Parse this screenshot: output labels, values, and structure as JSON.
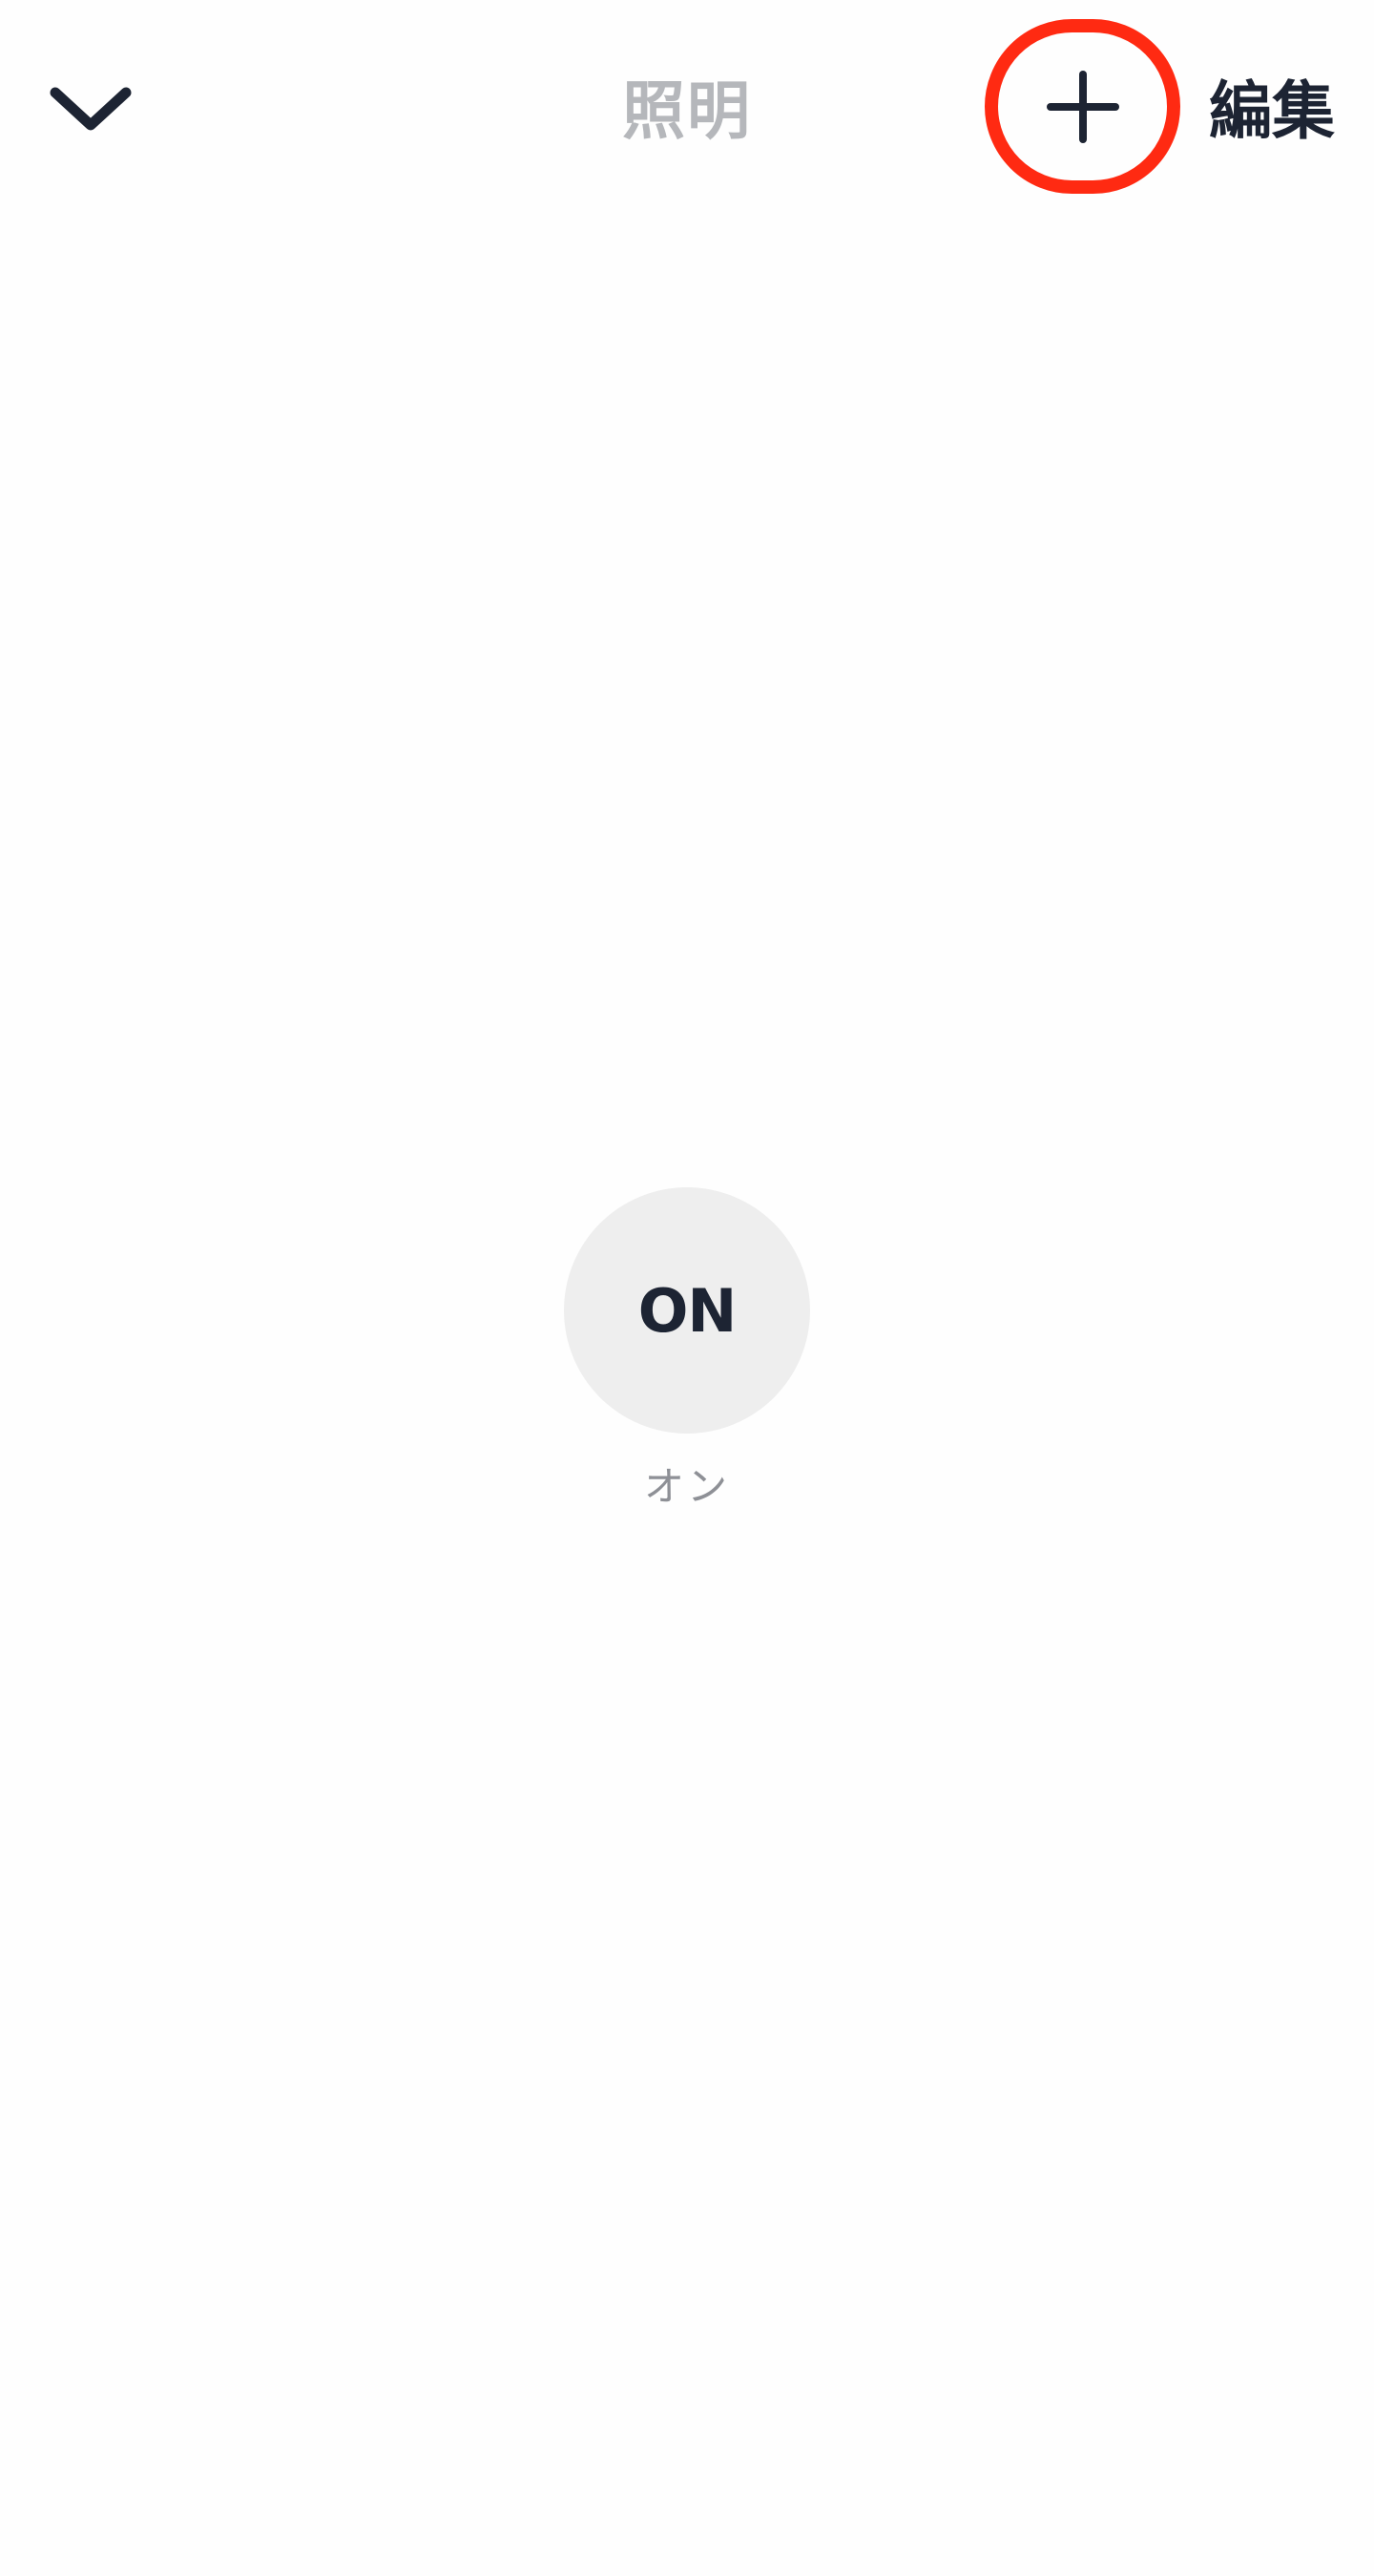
{
  "header": {
    "title": "照明",
    "add_icon": "plus-icon",
    "back_icon": "chevron-down-icon",
    "edit_label": "編集"
  },
  "main": {
    "power_button": {
      "label": "ON",
      "caption": "オン"
    }
  },
  "colors": {
    "title_gray": "#b5b7bb",
    "text_dark": "#1d2433",
    "highlight_red": "#ff2a12",
    "button_bg": "#eeeeee",
    "caption_gray": "#8e9096"
  }
}
